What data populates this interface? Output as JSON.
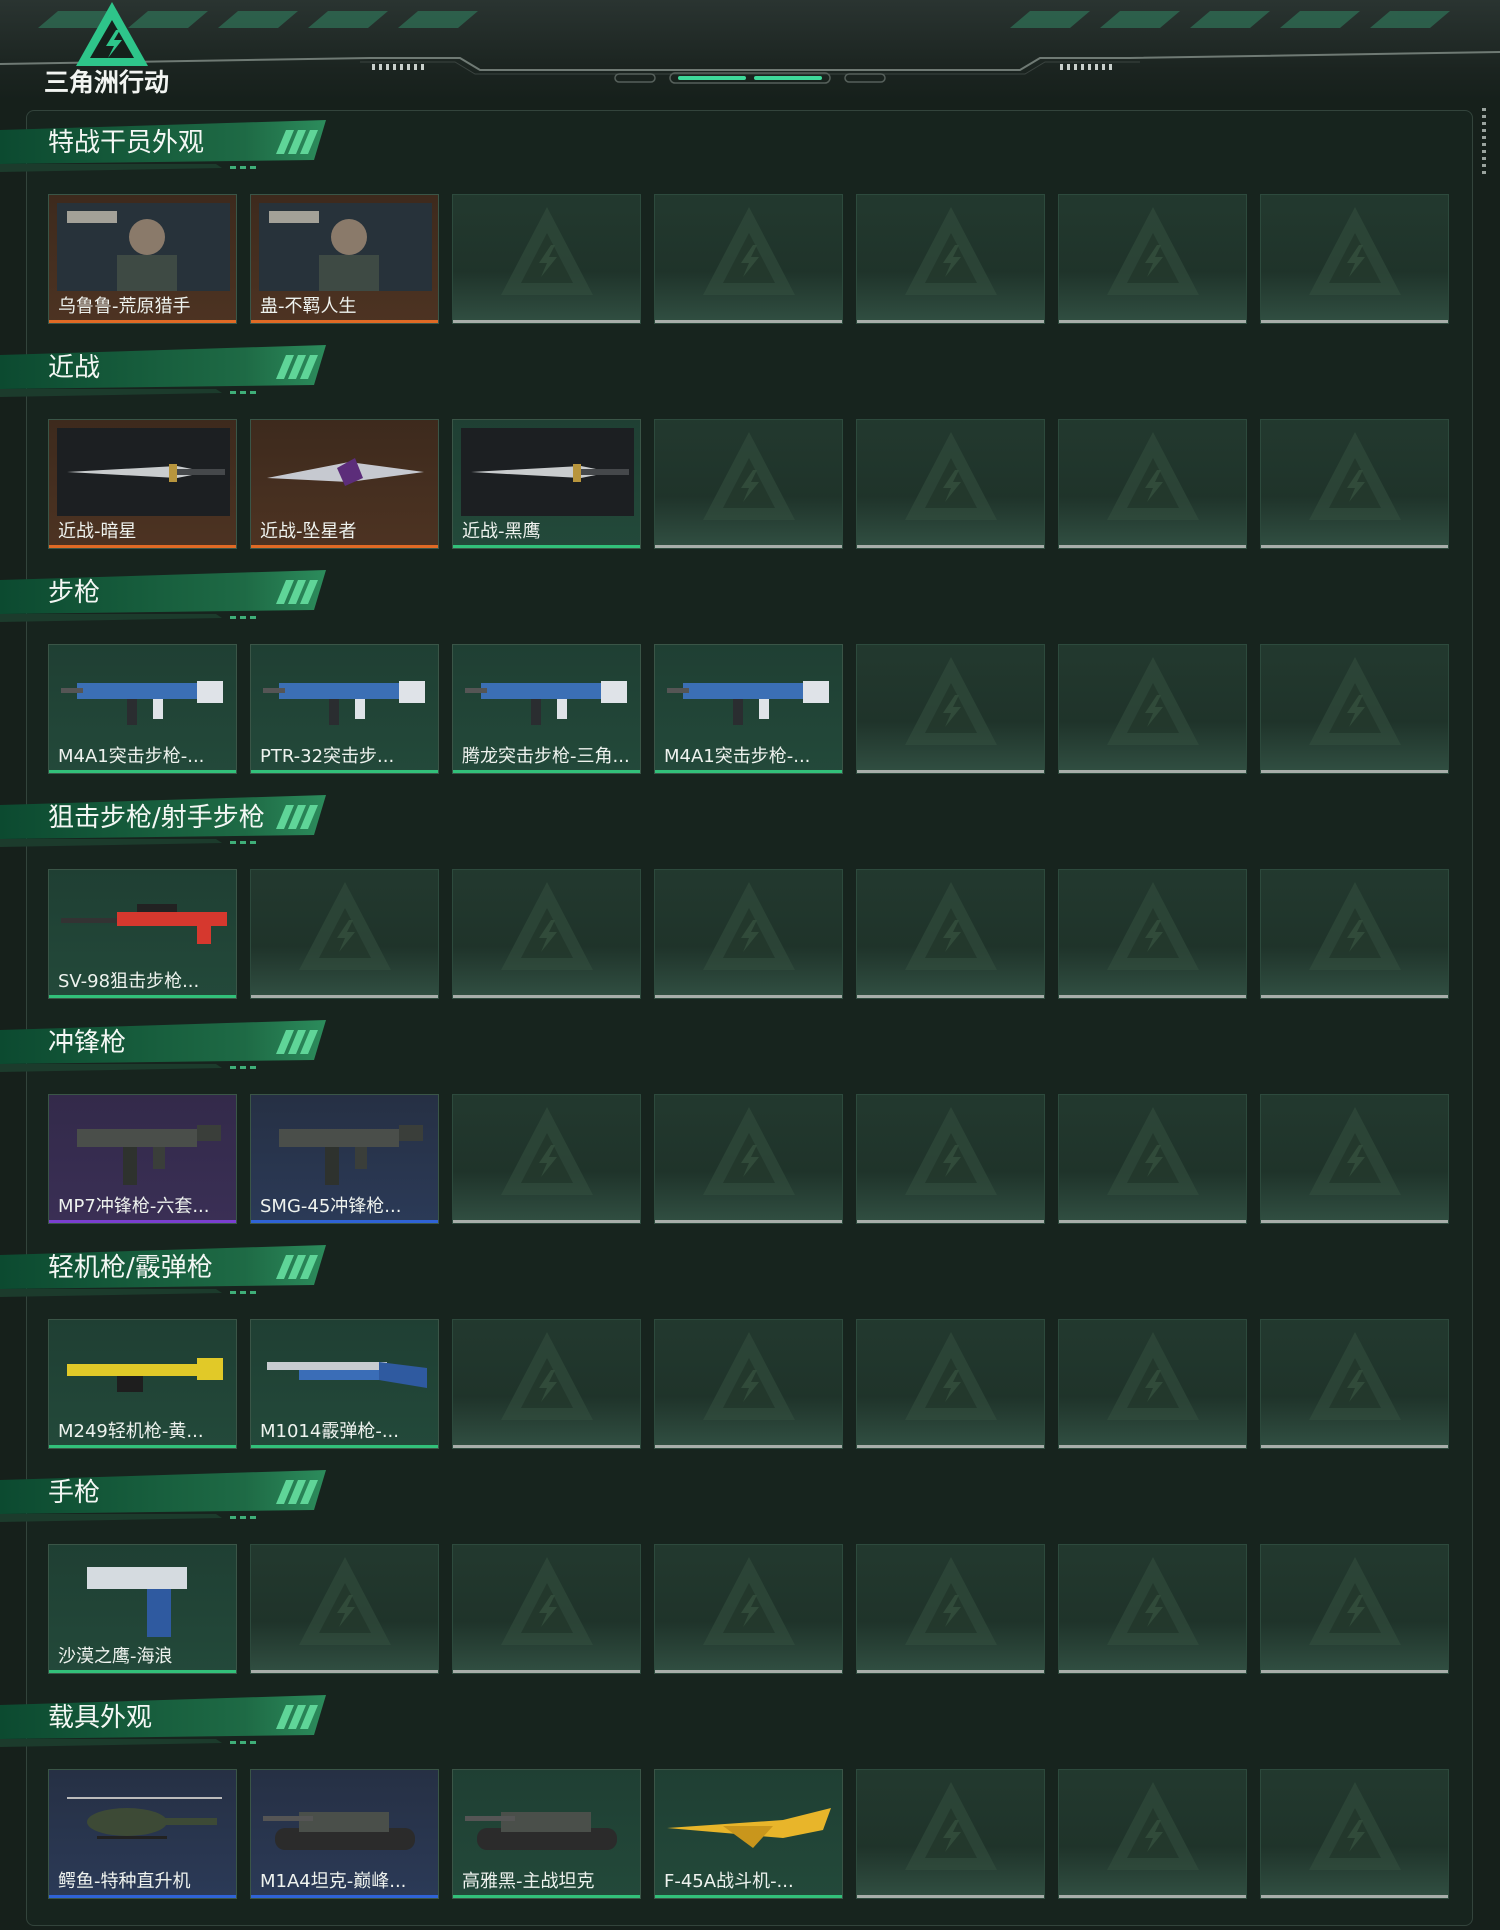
{
  "app": {
    "logo_text": "三角洲行动"
  },
  "colors": {
    "background": "#16201b",
    "accent_green": "#2ec27e",
    "rarity_orange": "#e06a25",
    "rarity_green": "#32c07a",
    "rarity_purple": "#7a3fd0",
    "rarity_blue": "#2f63d6",
    "empty_line": "#a8aeaa"
  },
  "sections": [
    {
      "title": "特战干员外观",
      "items": [
        {
          "label": "乌鲁鲁-荒原猎手",
          "rarity": "orange",
          "icon": "operator-portrait-icon"
        },
        {
          "label": "蛊-不羁人生",
          "rarity": "orange",
          "icon": "operator-portrait-icon"
        }
      ]
    },
    {
      "title": "近战",
      "items": [
        {
          "label": "近战-暗星",
          "rarity": "orange",
          "icon": "knife-icon"
        },
        {
          "label": "近战-坠星者",
          "rarity": "orange",
          "icon": "blade-icon"
        },
        {
          "label": "近战-黑鹰",
          "rarity": "green",
          "icon": "knife-icon"
        }
      ]
    },
    {
      "title": "步枪",
      "items": [
        {
          "label": "M4A1突击步枪-...",
          "rarity": "green",
          "icon": "rifle-icon"
        },
        {
          "label": "PTR-32突击步...",
          "rarity": "green",
          "icon": "rifle-icon"
        },
        {
          "label": "腾龙突击步枪-三角...",
          "rarity": "green",
          "icon": "rifle-icon"
        },
        {
          "label": "M4A1突击步枪-...",
          "rarity": "green",
          "icon": "rifle-icon"
        }
      ]
    },
    {
      "title": "狙击步枪/射手步枪",
      "items": [
        {
          "label": "SV-98狙击步枪...",
          "rarity": "green",
          "icon": "sniper-rifle-icon"
        }
      ]
    },
    {
      "title": "冲锋枪",
      "items": [
        {
          "label": "MP7冲锋枪-六套...",
          "rarity": "purple",
          "icon": "smg-icon"
        },
        {
          "label": "SMG-45冲锋枪...",
          "rarity": "blue",
          "icon": "smg-icon"
        }
      ]
    },
    {
      "title": "轻机枪/霰弹枪",
      "items": [
        {
          "label": "M249轻机枪-黄...",
          "rarity": "green",
          "icon": "machine-gun-icon"
        },
        {
          "label": "M1014霰弹枪-...",
          "rarity": "green",
          "icon": "shotgun-icon"
        }
      ]
    },
    {
      "title": "手枪",
      "items": [
        {
          "label": "沙漠之鹰-海浪",
          "rarity": "green",
          "icon": "pistol-icon"
        }
      ]
    },
    {
      "title": "载具外观",
      "items": [
        {
          "label": "鳄鱼-特种直升机",
          "rarity": "blue",
          "icon": "helicopter-icon"
        },
        {
          "label": "M1A4坦克-巅峰...",
          "rarity": "blue",
          "icon": "tank-icon"
        },
        {
          "label": "高雅黑-主战坦克",
          "rarity": "green",
          "icon": "tank-icon"
        },
        {
          "label": "F-45A战斗机-...",
          "rarity": "green",
          "icon": "jet-icon"
        }
      ]
    }
  ]
}
